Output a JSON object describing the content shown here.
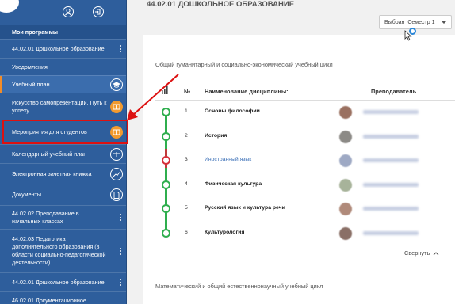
{
  "sidebar": {
    "heading": "Мои программы",
    "items": [
      {
        "label": "44.02.01 Дошкольное образование"
      },
      {
        "label": "Уведомления"
      },
      {
        "label": "Учебный план"
      },
      {
        "label": "Искусство самопрезентации. Путь к успеху"
      },
      {
        "label": "Мероприятия для студентов"
      },
      {
        "label": "Календарный учебный план"
      },
      {
        "label": "Электронная зачетная книжка"
      },
      {
        "label": "Документы"
      },
      {
        "label": "44.02.02 Преподавание в начальных классах"
      },
      {
        "label": "44.02.03 Педагогика дополнительного образования (в области социально-педагогической деятельности)"
      },
      {
        "label": "44.02.01 Дошкольное образование"
      },
      {
        "label": "46.02.01 Документационное"
      }
    ]
  },
  "main": {
    "title": "44.02.01 ДОШКОЛЬНОЕ ОБРАЗОВАНИЕ",
    "semester_prefix": "Выбран",
    "semester_value": "Семестр 1",
    "cycle1": "Общий гуманитарный и социально-экономический учебный цикл",
    "cycle2": "Математический и общий естественнонаучный учебный цикл",
    "headers": {
      "num": "№",
      "name": "Наименование дисциплины:",
      "teacher": "Преподаватель"
    },
    "rows": [
      {
        "num": "1",
        "name": "Основы философии",
        "status": "green",
        "avatar": "#9a7060"
      },
      {
        "num": "2",
        "name": "История",
        "status": "green",
        "avatar": "#8c8a86"
      },
      {
        "num": "3",
        "name": "Иностранный язык",
        "status": "red",
        "avatar": "#9ea9c4"
      },
      {
        "num": "4",
        "name": "Физическая культура",
        "status": "green",
        "avatar": "#a7b39a"
      },
      {
        "num": "5",
        "name": "Русский язык и культура речи",
        "status": "green",
        "avatar": "#b08a7a"
      },
      {
        "num": "6",
        "name": "Культурология",
        "status": "green",
        "avatar": "#8a6f66"
      }
    ],
    "collapse": "Свернуть"
  },
  "colors": {
    "sidebar": "#2e5e9c",
    "accent": "#f29a2e",
    "ok": "#2fae4e",
    "warn": "#d6303a",
    "annotation": "#dd1111"
  }
}
